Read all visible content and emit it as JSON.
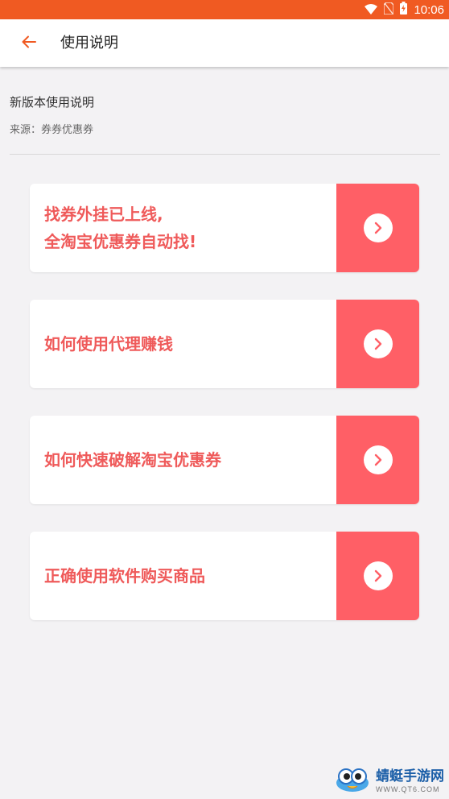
{
  "status_bar": {
    "time": "10:06",
    "color": "#f05a22",
    "icons": [
      "wifi-icon",
      "no-sim-icon",
      "battery-charging-icon"
    ]
  },
  "app_bar": {
    "title": "使用说明",
    "back_icon": "arrow-left-icon",
    "accent": "#f05a22"
  },
  "document": {
    "title": "新版本使用说明",
    "source": "来源：券券优惠券"
  },
  "cards": [
    {
      "lines": [
        "找券外挂已上线,",
        "全淘宝优惠券自动找!"
      ]
    },
    {
      "lines": [
        "如何使用代理赚钱"
      ]
    },
    {
      "lines": [
        "如何快速破解淘宝优惠券"
      ]
    },
    {
      "lines": [
        "正确使用软件购买商品"
      ]
    }
  ],
  "card_colors": {
    "text": "#ef5a5a",
    "action_bg": "#ff5f66"
  },
  "watermark": {
    "name": "蜻蜓手游网",
    "url": "WWW.QT6.COM"
  }
}
